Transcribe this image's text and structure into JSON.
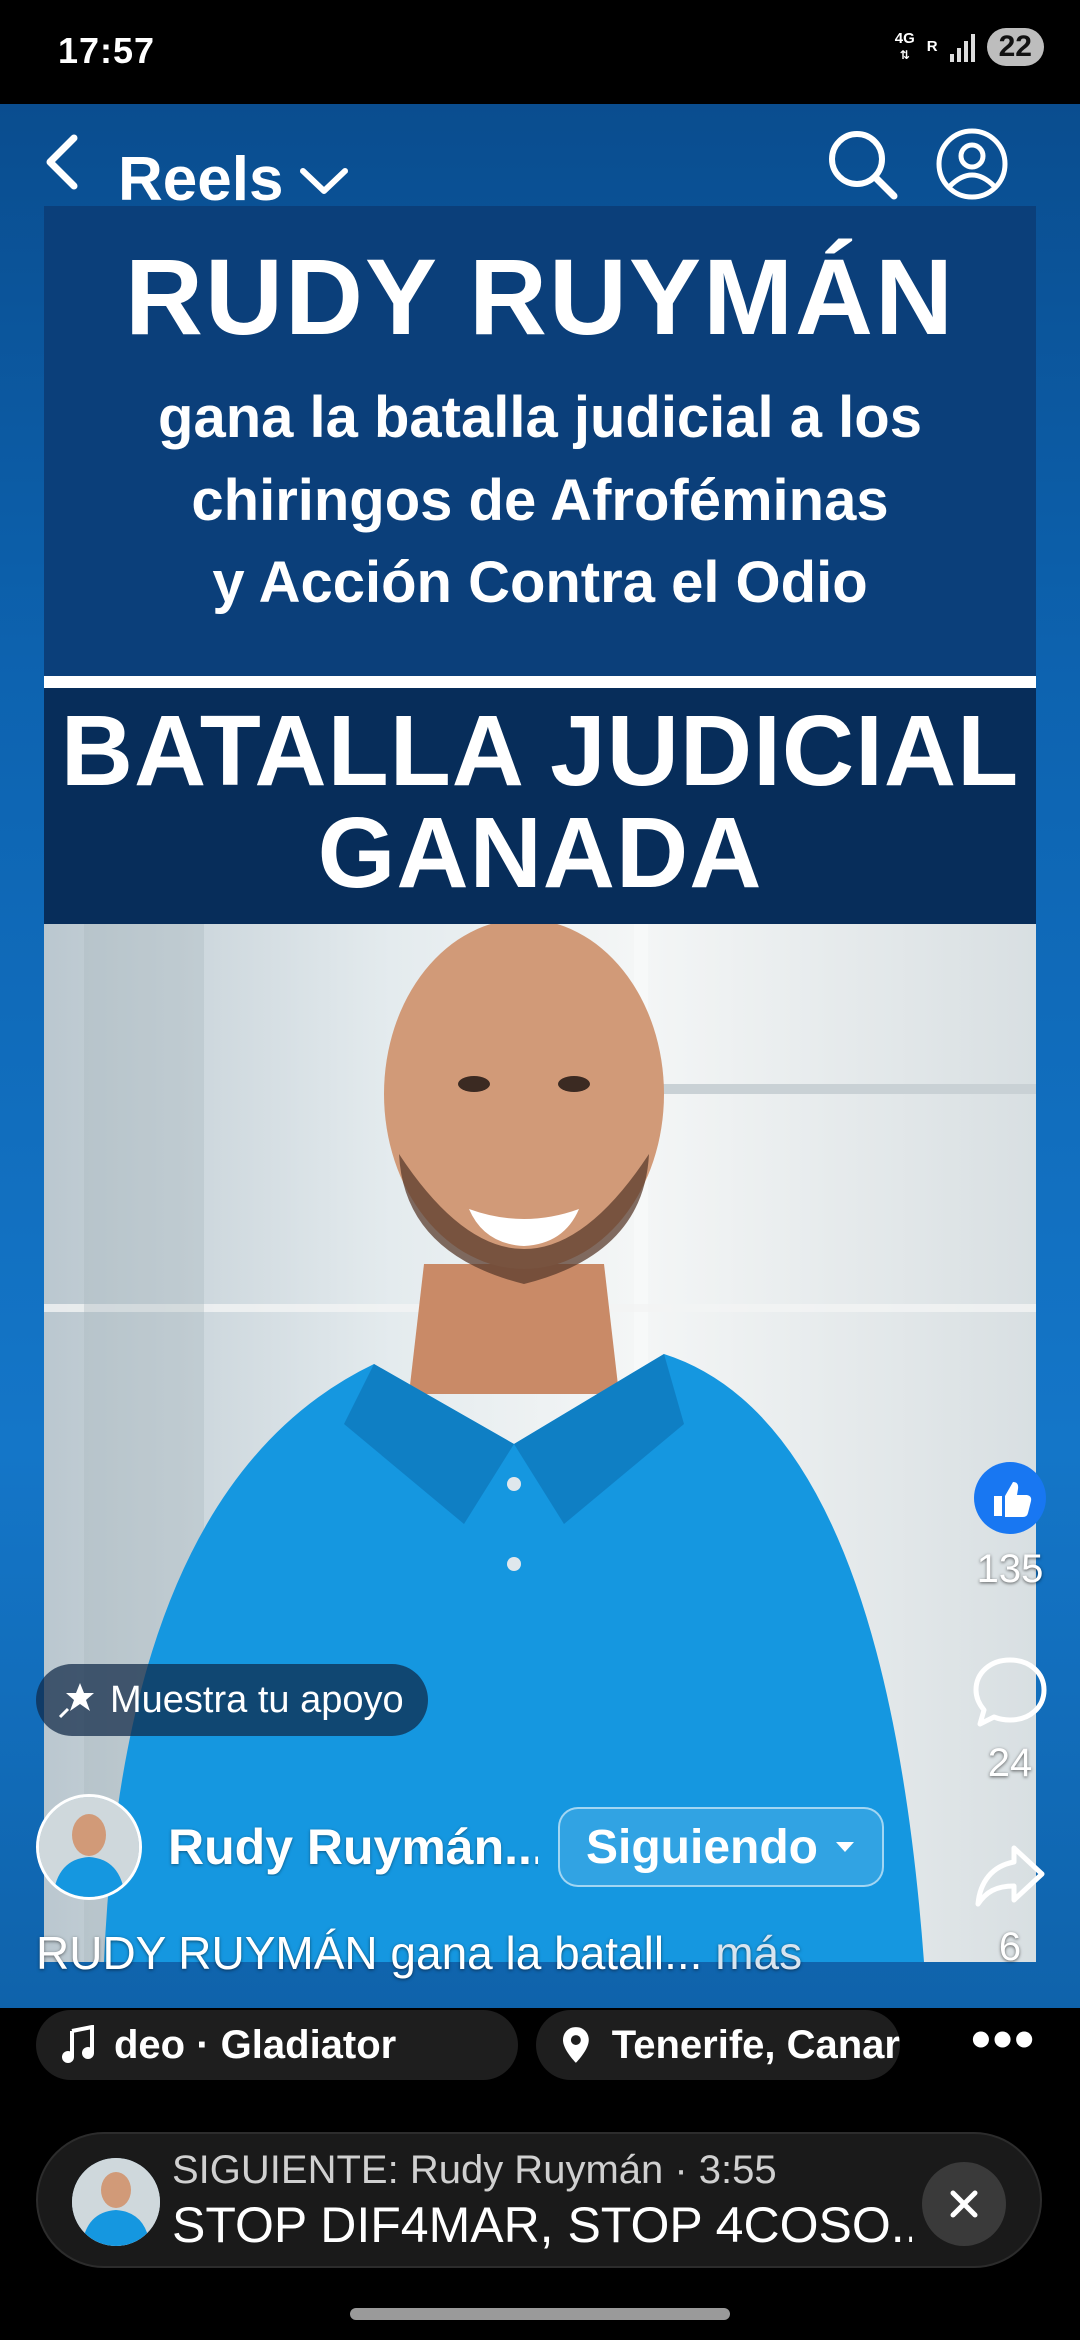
{
  "status": {
    "time": "17:57",
    "network": "4G",
    "network_sub": "R",
    "battery": "22"
  },
  "header": {
    "title": "Reels",
    "search_icon": "search-icon",
    "profile_icon": "profile-icon"
  },
  "poster": {
    "title": "RUDY RUYMÁN",
    "subtitle_lines": [
      "gana la batalla judicial a los",
      "chiringos de Afroféminas",
      "y Acción Contra el Odio"
    ],
    "banner_lines": [
      "BATALLA JUDICIAL",
      "GANADA"
    ]
  },
  "actions": {
    "likes": "135",
    "comments": "24",
    "shares": "6"
  },
  "support": {
    "label": "Muestra tu apoyo"
  },
  "author": {
    "name": "Rudy Ruymán...",
    "follow_label": "Siguiendo"
  },
  "caption": {
    "text": "RUDY RUYMÁN gana la batall...",
    "more": "más"
  },
  "info": {
    "audio": "deo · Gladiator",
    "location": "Tenerife, Canar"
  },
  "next": {
    "label": "SIGUIENTE: Rudy Ruymán · 3:55",
    "title": "STOP DIF4MAR, STOP 4COSO..."
  },
  "colors": {
    "reel_blue": "#0d63b0",
    "like_blue": "#1877f2",
    "poster_navy": "#072d5a"
  }
}
